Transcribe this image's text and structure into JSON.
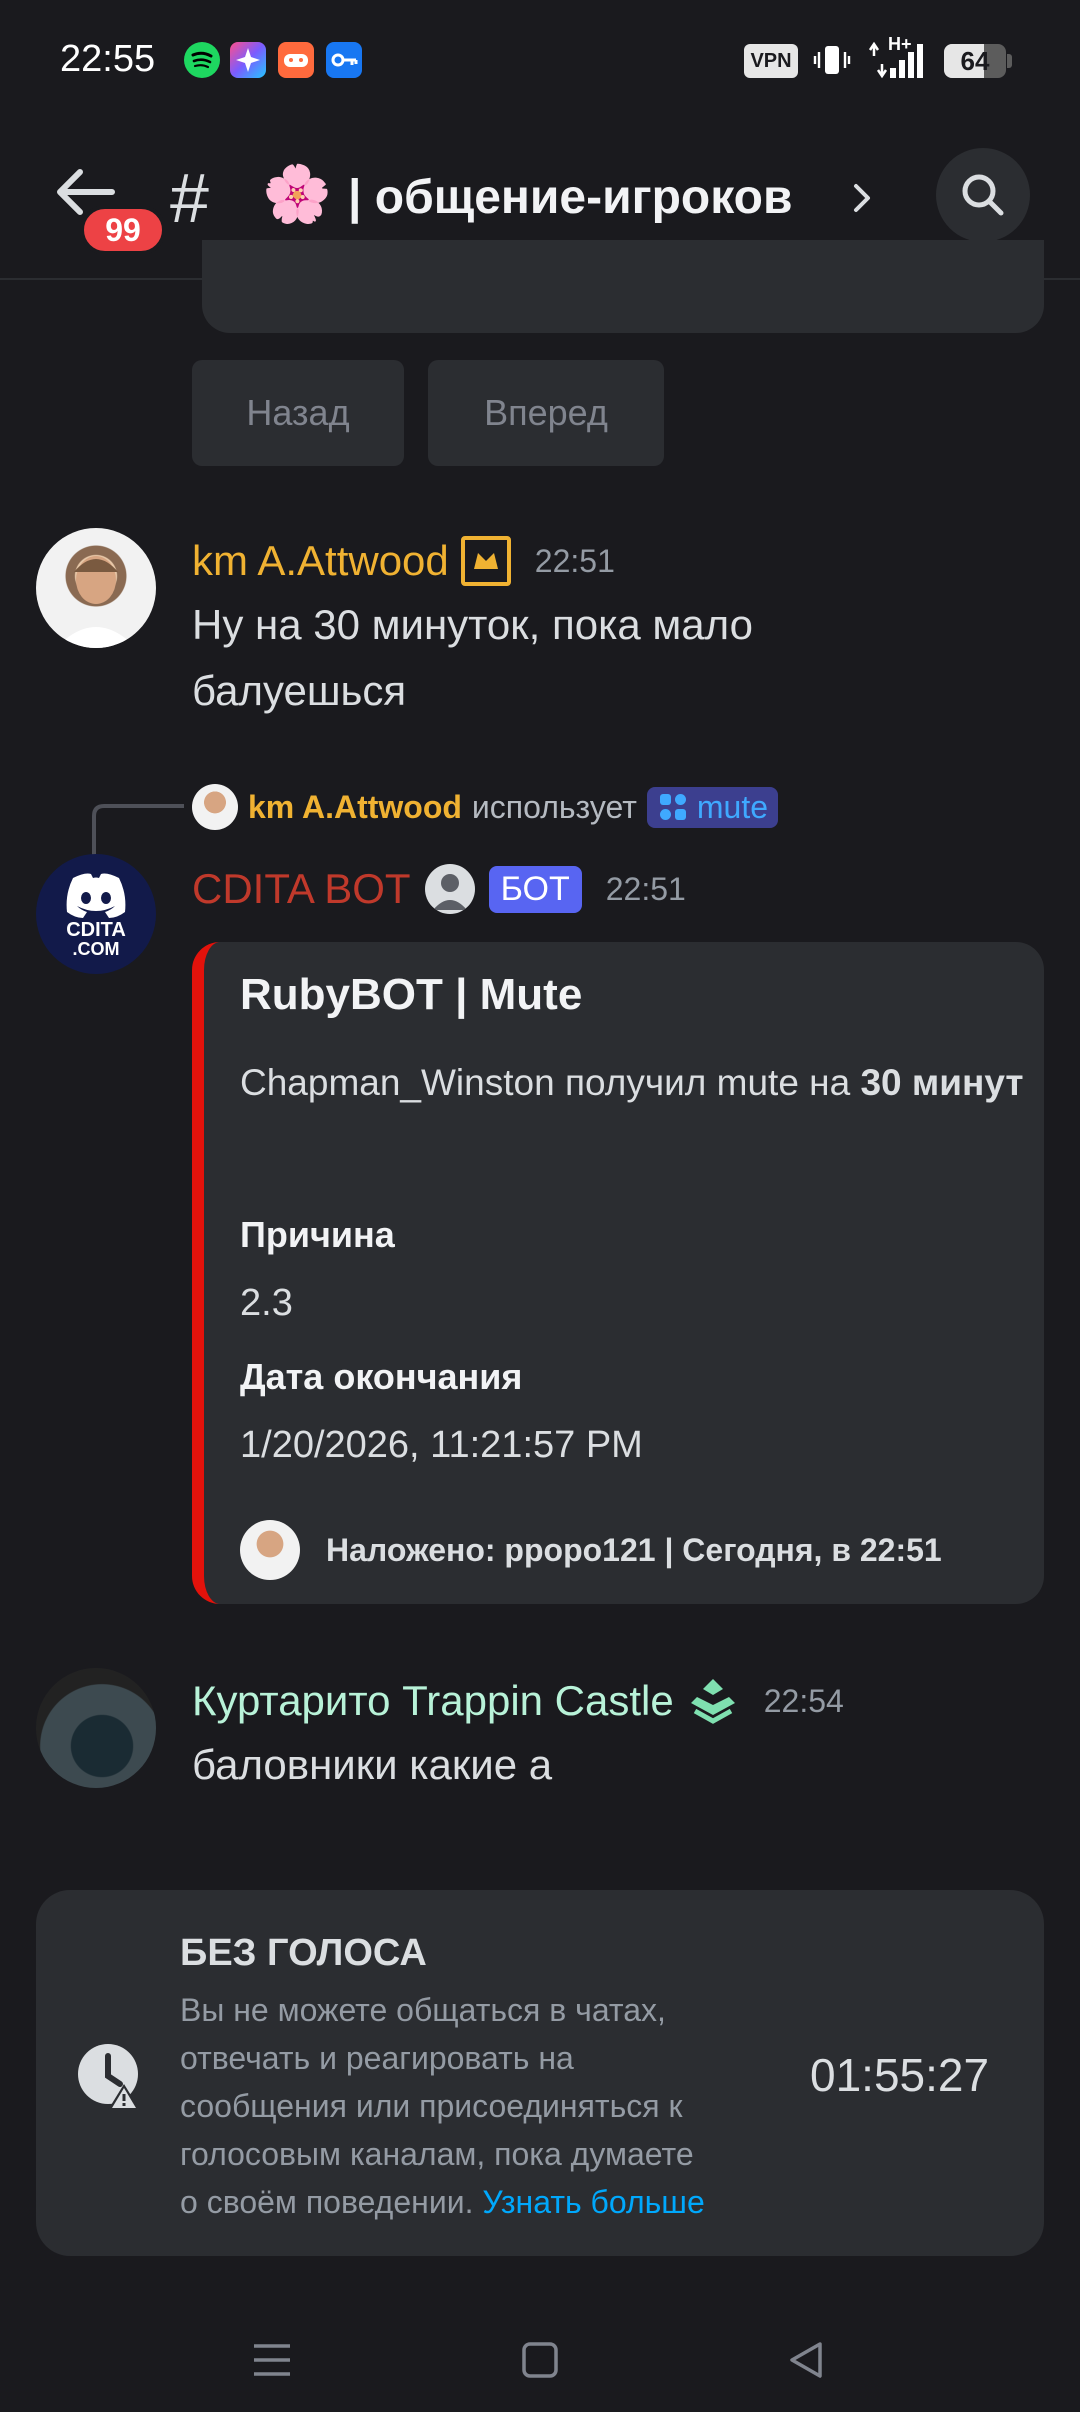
{
  "status_bar": {
    "time": "22:55",
    "vpn_label": "VPN",
    "network": "H+",
    "battery": "64"
  },
  "header": {
    "badge": "99",
    "hash": "#",
    "emoji": "🌸",
    "title": "| общение-игроков"
  },
  "pagination": {
    "back_label": "Назад",
    "next_label": "Вперед"
  },
  "messages": [
    {
      "author": "km A.Attwood",
      "author_color": "#f0b232",
      "time": "22:51",
      "text_line1": "Ну на 30 минуток, пока мало",
      "text_line2": "балуешься"
    },
    {
      "reply_author": "km A.Attwood",
      "reply_uses": "использует",
      "reply_command": "mute",
      "author": "CDITA BOT",
      "author_color": "#c0392b",
      "bot_tag": "БОТ",
      "time": "22:51",
      "avatar_text_1": "CDITA",
      "avatar_text_2": ".COM"
    },
    {
      "author": "Куртарито Trappin Castle",
      "author_color": "#b8f2d8",
      "time": "22:54",
      "text": "баловники какие а"
    }
  ],
  "embed": {
    "title": "RubyBOT | Mute",
    "desc_plain": "Chapman_Winston получил mute на",
    "desc_bold_1": "30",
    "desc_bold_2": "минут",
    "field1_name": "Причина",
    "field1_value": "2.3",
    "field2_name": "Дата окончания",
    "field2_value": "1/20/2026, 11:21:57 PM",
    "footer": "Наложено: ppopo121 | Сегодня, в 22:51",
    "accent_color": "#e3120b"
  },
  "timeout": {
    "title": "БЕЗ ГОЛОСА",
    "line1": "Вы не можете общаться в чатах,",
    "line2": "отвечать и реагировать на",
    "line3": "сообщения или присоединяться к",
    "line4": "голосовым каналам, пока думаете",
    "line5": "о своём поведении.",
    "link": "Узнать больше",
    "countdown": "01:55:27"
  }
}
